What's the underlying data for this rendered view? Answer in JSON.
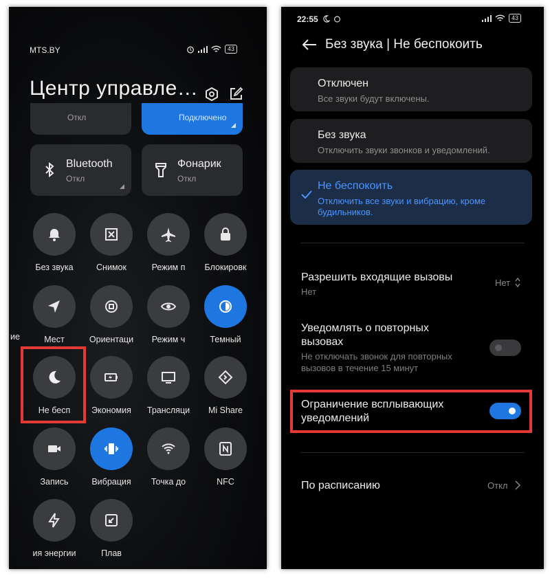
{
  "left": {
    "carrier": "MTS.BY",
    "battery": "43",
    "title": "Центр управле…",
    "partial_tiles": [
      {
        "status": "Откл"
      },
      {
        "status": "Подключено"
      }
    ],
    "big_tiles": [
      {
        "title": "Bluetooth",
        "status": "Откл",
        "icon": "bluetooth-icon"
      },
      {
        "title": "Фонарик",
        "status": "Откл",
        "icon": "flashlight-icon"
      }
    ],
    "toggles": [
      {
        "label": "Без звука",
        "icon": "bell-icon",
        "on": false
      },
      {
        "label": "Снимок",
        "icon": "screenshot-icon",
        "on": false
      },
      {
        "label": "Режим п",
        "icon": "airplane-icon",
        "on": false
      },
      {
        "label": "Блокировк",
        "icon": "lock-icon",
        "on": false
      },
      {
        "label": "Мест",
        "icon": "location-icon",
        "on": false
      },
      {
        "label": "Ориентаци",
        "icon": "rotation-icon",
        "on": false
      },
      {
        "label": "Режим ч",
        "icon": "eye-icon",
        "on": false
      },
      {
        "label": "Темный",
        "icon": "dark-mode-icon",
        "on": true
      },
      {
        "label": "Не бесп",
        "icon": "moon-icon",
        "on": false
      },
      {
        "label": "Экономия",
        "icon": "battery-saver-icon",
        "on": false
      },
      {
        "label": "Трансляци",
        "icon": "cast-icon",
        "on": false
      },
      {
        "label": "Mi Share",
        "icon": "mi-share-icon",
        "on": false
      },
      {
        "label": "Запись",
        "icon": "video-record-icon",
        "on": false
      },
      {
        "label": "Вибрация",
        "icon": "vibration-icon",
        "on": true
      },
      {
        "label": "Точка до",
        "icon": "hotspot-icon",
        "on": false
      },
      {
        "label": "NFC",
        "icon": "nfc-icon",
        "on": false
      },
      {
        "label": "ия энергии",
        "icon": "lightning-icon",
        "on": false
      },
      {
        "label": "Плав",
        "icon": "floating-window-icon",
        "on": false
      }
    ],
    "cut_label": "ие"
  },
  "right": {
    "time": "22:55",
    "battery": "43",
    "title": "Без звука | Не беспокоить",
    "modes": [
      {
        "title": "Отключен",
        "subtitle": "Все звуки будут включены.",
        "selected": false
      },
      {
        "title": "Без звука",
        "subtitle": "Отключить звуки звонков и уведомлений.",
        "selected": false
      },
      {
        "title": "Не беспокоить",
        "subtitle": "Отключить все звуки и вибрацию, кроме будильников.",
        "selected": true
      }
    ],
    "allow_calls": {
      "title": "Разрешить входящие вызовы",
      "subtitle": "Нет",
      "value": "Нет"
    },
    "repeat_calls": {
      "title": "Уведомлять о повторных вызовах",
      "subtitle": "Не отключать звонок для повторных вызовов в течение 15 минут",
      "on": false
    },
    "limit_popups": {
      "title": "Ограничение всплывающих уведомлений",
      "on": true
    },
    "schedule": {
      "title": "По расписанию",
      "value": "Откл"
    },
    "accent": "#1e77e0",
    "highlight": "#e53935"
  }
}
